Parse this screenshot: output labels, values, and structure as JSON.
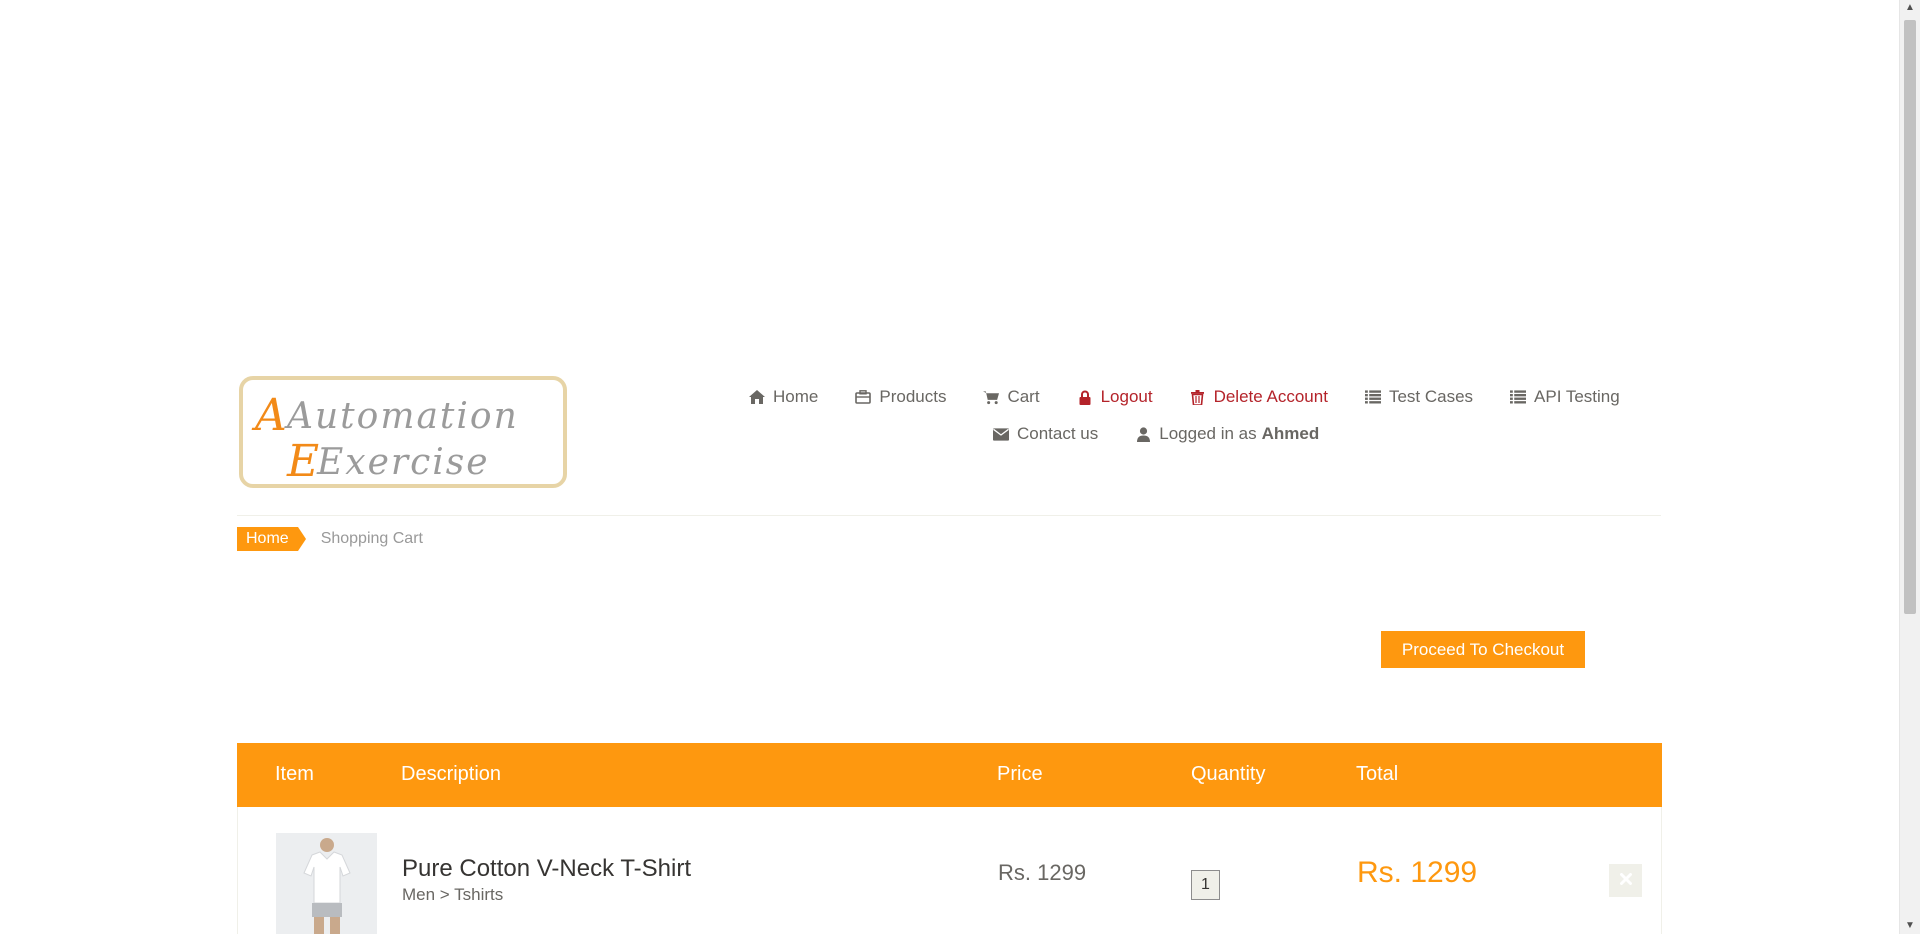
{
  "logo": {
    "line1": "Automation",
    "line2": "Exercise"
  },
  "nav": {
    "home": {
      "label": "Home",
      "icon": "home-icon"
    },
    "products": {
      "label": "Products",
      "icon": "briefcase-icon"
    },
    "cart": {
      "label": "Cart",
      "icon": "shopping-cart-icon"
    },
    "logout": {
      "label": "Logout",
      "icon": "lock-icon"
    },
    "delete_account": {
      "label": "Delete Account",
      "icon": "trash-icon"
    },
    "test_cases": {
      "label": "Test Cases",
      "icon": "list-icon"
    },
    "api_testing": {
      "label": "API Testing",
      "icon": "list-icon"
    },
    "contact_us": {
      "label": "Contact us",
      "icon": "envelope-icon"
    },
    "logged_in_prefix": "Logged in as",
    "logged_in_user": "Ahmed"
  },
  "breadcrumb": {
    "home": "Home",
    "current": "Shopping Cart"
  },
  "checkout_button": "Proceed To Checkout",
  "cart_table": {
    "headers": {
      "item": "Item",
      "description": "Description",
      "price": "Price",
      "quantity": "Quantity",
      "total": "Total"
    },
    "rows": [
      {
        "name": "Pure Cotton V-Neck T-Shirt",
        "category": "Men > Tshirts",
        "price": "Rs. 1299",
        "quantity": "1",
        "total": "Rs. 1299"
      }
    ]
  },
  "colors": {
    "accent": "#fe980f",
    "danger": "#b4232a",
    "text": "#696763",
    "logo_border": "#e7d4a6"
  }
}
